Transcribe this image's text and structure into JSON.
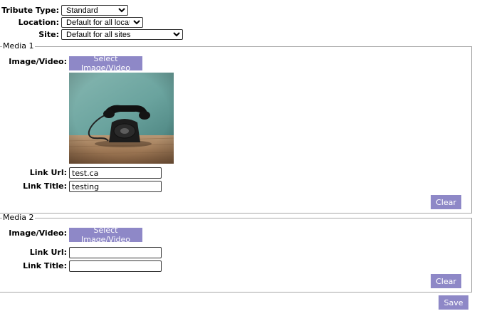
{
  "form": {
    "tribute_type": {
      "label": "Tribute Type:",
      "value": "Standard"
    },
    "location": {
      "label": "Location:",
      "value": "Default for all locations"
    },
    "site": {
      "label": "Site:",
      "value": "Default for all sites"
    }
  },
  "media1": {
    "legend": "Media 1",
    "image_label": "Image/Video:",
    "select_button": "Select Image/Video",
    "image_alt": "rotary telephone",
    "link_url_label": "Link Url:",
    "link_url_value": "test.ca",
    "link_title_label": "Link Title:",
    "link_title_value": "testing",
    "clear_button": "Clear"
  },
  "media2": {
    "legend": "Media 2",
    "image_label": "Image/Video:",
    "select_button": "Select Image/Video",
    "link_url_label": "Link Url:",
    "link_url_value": "",
    "link_title_label": "Link Title:",
    "link_title_value": "",
    "clear_button": "Clear"
  },
  "save_button": "Save",
  "colors": {
    "accent_button": "#8e88c7",
    "fieldset_border": "#a9a9a9"
  }
}
